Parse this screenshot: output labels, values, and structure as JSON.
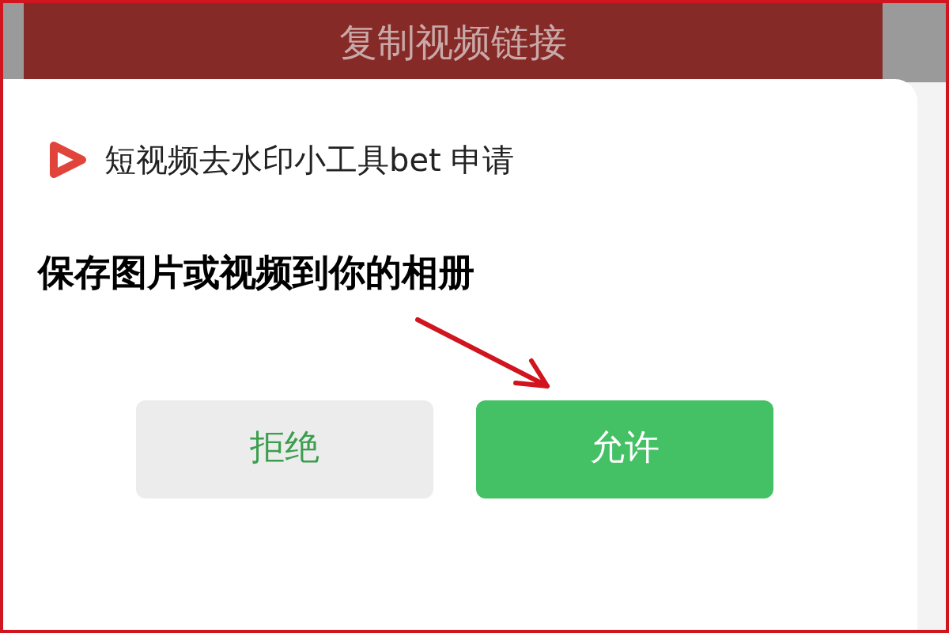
{
  "header_bar": {
    "title": "复制视频链接"
  },
  "dialog": {
    "app_name": "短视频去水印小工具bet 申请",
    "message": "保存图片或视频到你的相册",
    "buttons": [
      {
        "label": "拒绝",
        "kind": "secondary"
      },
      {
        "label": "允许",
        "kind": "primary"
      }
    ]
  }
}
